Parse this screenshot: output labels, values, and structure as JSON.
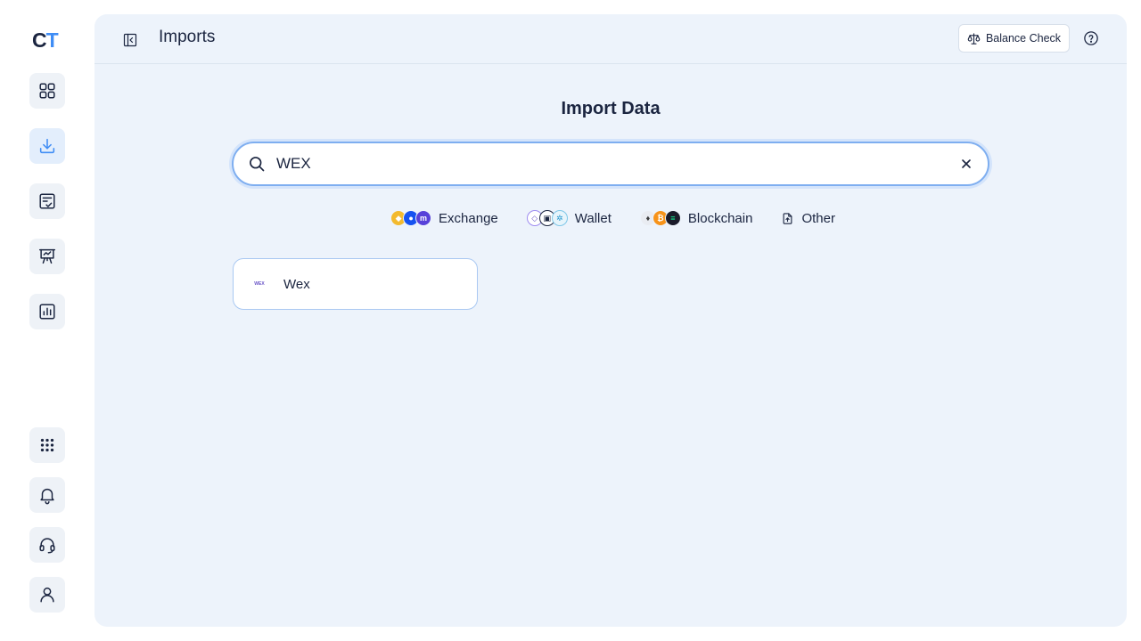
{
  "logo": {
    "part1": "C",
    "part2": "T"
  },
  "sidebar": {
    "items": [
      {
        "name": "dashboard",
        "icon": "grid-icon"
      },
      {
        "name": "imports",
        "icon": "download-icon",
        "active": true
      },
      {
        "name": "transactions",
        "icon": "checklist-icon"
      },
      {
        "name": "reports",
        "icon": "presentation-icon"
      },
      {
        "name": "analytics",
        "icon": "chart-icon"
      }
    ],
    "bottom_items": [
      {
        "name": "apps",
        "icon": "dots-grid-icon"
      },
      {
        "name": "notifications",
        "icon": "bell-icon"
      },
      {
        "name": "support",
        "icon": "headset-icon"
      },
      {
        "name": "profile",
        "icon": "user-icon"
      }
    ]
  },
  "header": {
    "title": "Imports",
    "balance_check_label": "Balance Check"
  },
  "main": {
    "heading": "Import Data",
    "search": {
      "value": "WEX",
      "placeholder": ""
    },
    "filters": [
      {
        "label": "Exchange"
      },
      {
        "label": "Wallet"
      },
      {
        "label": "Blockchain"
      },
      {
        "label": "Other"
      }
    ],
    "results": [
      {
        "name": "Wex",
        "logo_text": "WEX"
      }
    ]
  },
  "colors": {
    "accent": "#3f8df5",
    "panel_bg": "#edf3fb",
    "text": "#1b2540"
  }
}
